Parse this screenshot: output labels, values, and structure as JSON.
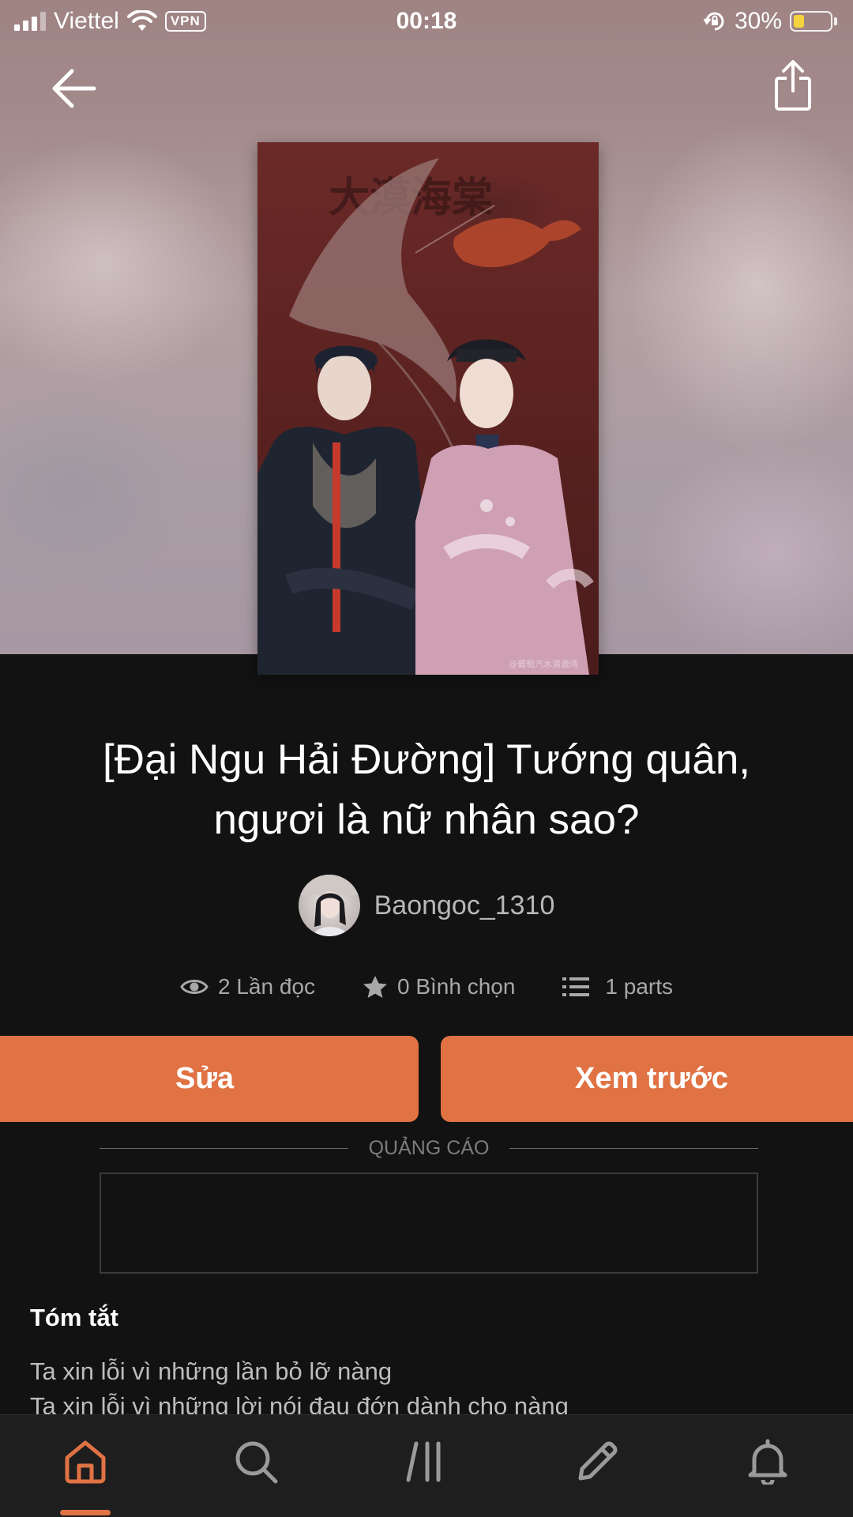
{
  "status_bar": {
    "carrier": "Viettel",
    "vpn": "VPN",
    "time": "00:18",
    "battery": "30%",
    "battery_level": 0.3
  },
  "cover": {
    "calligraphy": "大漠海棠",
    "watermark": "@葡萄汽水清澈湾"
  },
  "story": {
    "title_line1": "[Đại Ngu Hải Đường] Tướng quân,",
    "title_line2": "ngươi là nữ nhân sao?",
    "author": "Baongoc_1310"
  },
  "stats": {
    "reads": "2 Lần đọc",
    "votes": "0 Bình chọn",
    "parts": "1 parts"
  },
  "actions": {
    "edit": "Sửa",
    "preview": "Xem trước"
  },
  "ad": {
    "label": "QUẢNG CÁO"
  },
  "summary": {
    "heading": "Tóm tắt",
    "lines": [
      "Ta xin lỗi vì những lần bỏ lỡ nàng",
      "Ta xin lỗi vì những lời nói đau đớn dành cho nàng"
    ]
  },
  "nav": {
    "active": "home",
    "items": [
      "home",
      "search",
      "library",
      "write",
      "notifications"
    ]
  },
  "colors": {
    "accent": "#e07244",
    "background": "#121212",
    "nav_background": "#1e1e1e"
  }
}
